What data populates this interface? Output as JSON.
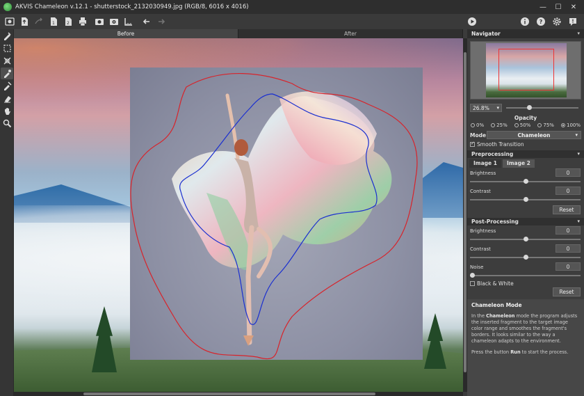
{
  "window": {
    "title": "AKVIS Chameleon v.12.1 - shutterstock_2132030949.jpg (RGB/8, 6016 x 4016)",
    "controls": [
      "minimize-icon",
      "maximize-icon",
      "close-icon"
    ]
  },
  "view_tabs": [
    {
      "label": "Before",
      "active": true
    },
    {
      "label": "After",
      "active": false
    }
  ],
  "navigator": {
    "title": "Navigator",
    "zoom": "26.8%"
  },
  "opacity": {
    "title": "Opacity",
    "options": [
      "0%",
      "25%",
      "50%",
      "75%",
      "100%"
    ],
    "selected": "100%"
  },
  "mode": {
    "label": "Mode",
    "value": "Chameleon"
  },
  "smooth_transition": {
    "label": "Smooth Transition",
    "checked": true
  },
  "preprocessing": {
    "title": "Preprocessing",
    "tabs": [
      "Image 1",
      "Image 2"
    ],
    "active_tab": "Image 2",
    "brightness": {
      "label": "Brightness",
      "value": "0"
    },
    "contrast": {
      "label": "Contrast",
      "value": "0"
    },
    "reset": "Reset"
  },
  "postprocessing": {
    "title": "Post-Processing",
    "brightness": {
      "label": "Brightness",
      "value": "0"
    },
    "contrast": {
      "label": "Contrast",
      "value": "0"
    },
    "noise": {
      "label": "Noise",
      "value": "0"
    },
    "black_white": {
      "label": "Black & White",
      "checked": false
    },
    "reset": "Reset"
  },
  "help": {
    "title": "Chameleon Mode",
    "p1_a": "In the ",
    "p1_b": "Chameleon",
    "p1_c": " mode the program adjusts the inserted fragment to the target image color range and smoothes the fragment's borders. It looks similar to the way a chameleon adapts to the environment.",
    "p2_a": "Press the button ",
    "p2_b": "Run",
    "p2_c": " to start the process."
  },
  "colors": {
    "outline_red": "#d8232a",
    "outline_blue": "#1a2fd0",
    "panel_bg": "#3d3d3d"
  }
}
